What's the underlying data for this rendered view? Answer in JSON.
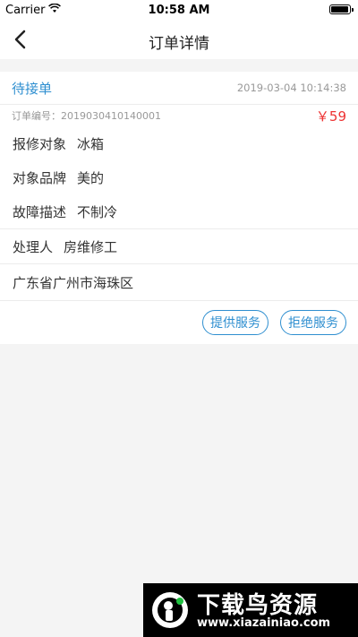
{
  "status_bar": {
    "carrier": "Carrier",
    "time": "10:58 AM",
    "battery_level": 0.95
  },
  "nav": {
    "title": "订单详情",
    "back_icon": "chevron-left-icon"
  },
  "order": {
    "status": "待接单",
    "datetime": "2019-03-04 10:14:38",
    "order_number": "订单编号：2019030410140001",
    "price": "￥59",
    "repair_object_label": "报修对象",
    "repair_object_value": "冰箱",
    "brand_label": "对象品牌",
    "brand_value": "美的",
    "fault_label": "故障描述",
    "fault_value": "不制冷",
    "handler_label": "处理人",
    "handler_value": "房维修工",
    "address": "广东省广州市海珠区"
  },
  "actions": {
    "provide": "提供服务",
    "reject": "拒绝服务"
  },
  "watermark": {
    "name": "下载鸟资源",
    "url": "www.xiazainiao.com"
  },
  "colors": {
    "accent": "#2f8fd0",
    "price": "#e33333",
    "background": "#f4f4f4"
  }
}
